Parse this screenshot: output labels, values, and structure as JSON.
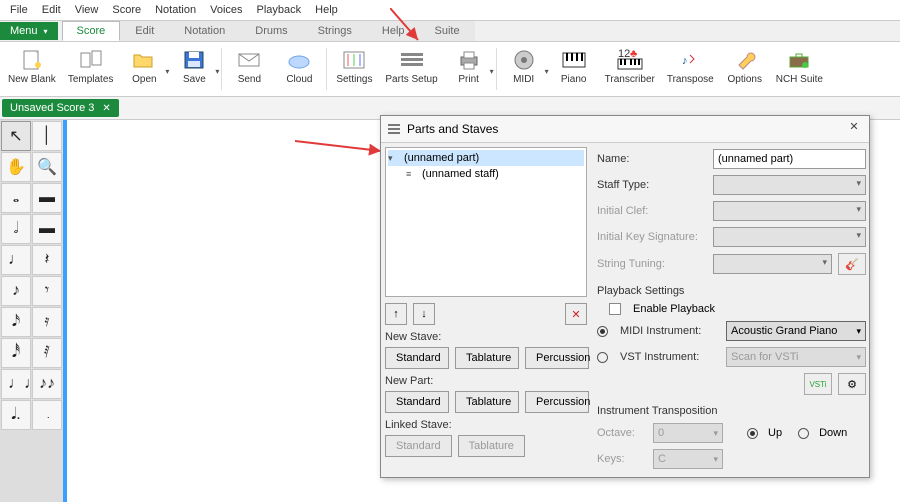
{
  "menubar": [
    "File",
    "Edit",
    "View",
    "Score",
    "Notation",
    "Voices",
    "Playback",
    "Help"
  ],
  "menu_button": "Menu",
  "tabs": [
    "Score",
    "Edit",
    "Notation",
    "Drums",
    "Strings",
    "Help",
    "Suite"
  ],
  "active_tab": 0,
  "toolbar": [
    {
      "label": "New Blank",
      "icon": "page-sparkle"
    },
    {
      "label": "Templates",
      "icon": "templates"
    },
    {
      "label": "Open",
      "icon": "folder-open",
      "drop": true
    },
    {
      "label": "Save",
      "icon": "disk",
      "drop": true
    },
    {
      "label": "Send",
      "icon": "envelope"
    },
    {
      "label": "Cloud",
      "icon": "cloud"
    },
    {
      "label": "Settings",
      "icon": "sliders"
    },
    {
      "label": "Parts Setup",
      "icon": "parts"
    },
    {
      "label": "Print",
      "icon": "printer",
      "drop": true
    },
    {
      "label": "MIDI",
      "icon": "disc",
      "drop": true
    },
    {
      "label": "Piano",
      "icon": "piano"
    },
    {
      "label": "Transcriber",
      "icon": "keyboard-12"
    },
    {
      "label": "Transpose",
      "icon": "transpose"
    },
    {
      "label": "Options",
      "icon": "wrench"
    },
    {
      "label": "NCH Suite",
      "icon": "briefcase"
    }
  ],
  "doc_tab": "Unsaved Score 3",
  "palette_glyphs": [
    "↖",
    "│",
    "✋",
    "🔍",
    "𝅝",
    "▬",
    "𝅗𝅥",
    "▬",
    "♩",
    "𝄽",
    "♪",
    "𝄾",
    "𝅘𝅥𝅯",
    "𝄿",
    "𝅘𝅥𝅰",
    "𝅀",
    "♩♩♩",
    "♪♪",
    "𝅘𝅥.",
    "𝅭"
  ],
  "dialog": {
    "title": "Parts and Staves",
    "tree": {
      "part": "(unnamed part)",
      "staff": "(unnamed staff)"
    },
    "arrows": {
      "up": "↑",
      "down": "↓",
      "del": "✕"
    },
    "new_stave_label": "New Stave:",
    "new_part_label": "New Part:",
    "linked_stave_label": "Linked Stave:",
    "btn_standard": "Standard",
    "btn_tablature": "Tablature",
    "btn_percussion": "Percussion",
    "name_label": "Name:",
    "name_value": "(unnamed part)",
    "staff_type_label": "Staff Type:",
    "initial_clef_label": "Initial Clef:",
    "initial_key_label": "Initial Key Signature:",
    "string_tuning_label": "String Tuning:",
    "playback_title": "Playback Settings",
    "enable_playback": "Enable Playback",
    "midi_instr_label": "MIDI Instrument:",
    "midi_instr_value": "Acoustic Grand Piano",
    "vst_instr_label": "VST Instrument:",
    "vst_instr_value": "Scan for VSTi",
    "vsti_btn": "VSTi",
    "transposition_title": "Instrument Transposition",
    "octave_label": "Octave:",
    "octave_value": "0",
    "keys_label": "Keys:",
    "keys_value": "C",
    "up_label": "Up",
    "down_label": "Down"
  }
}
